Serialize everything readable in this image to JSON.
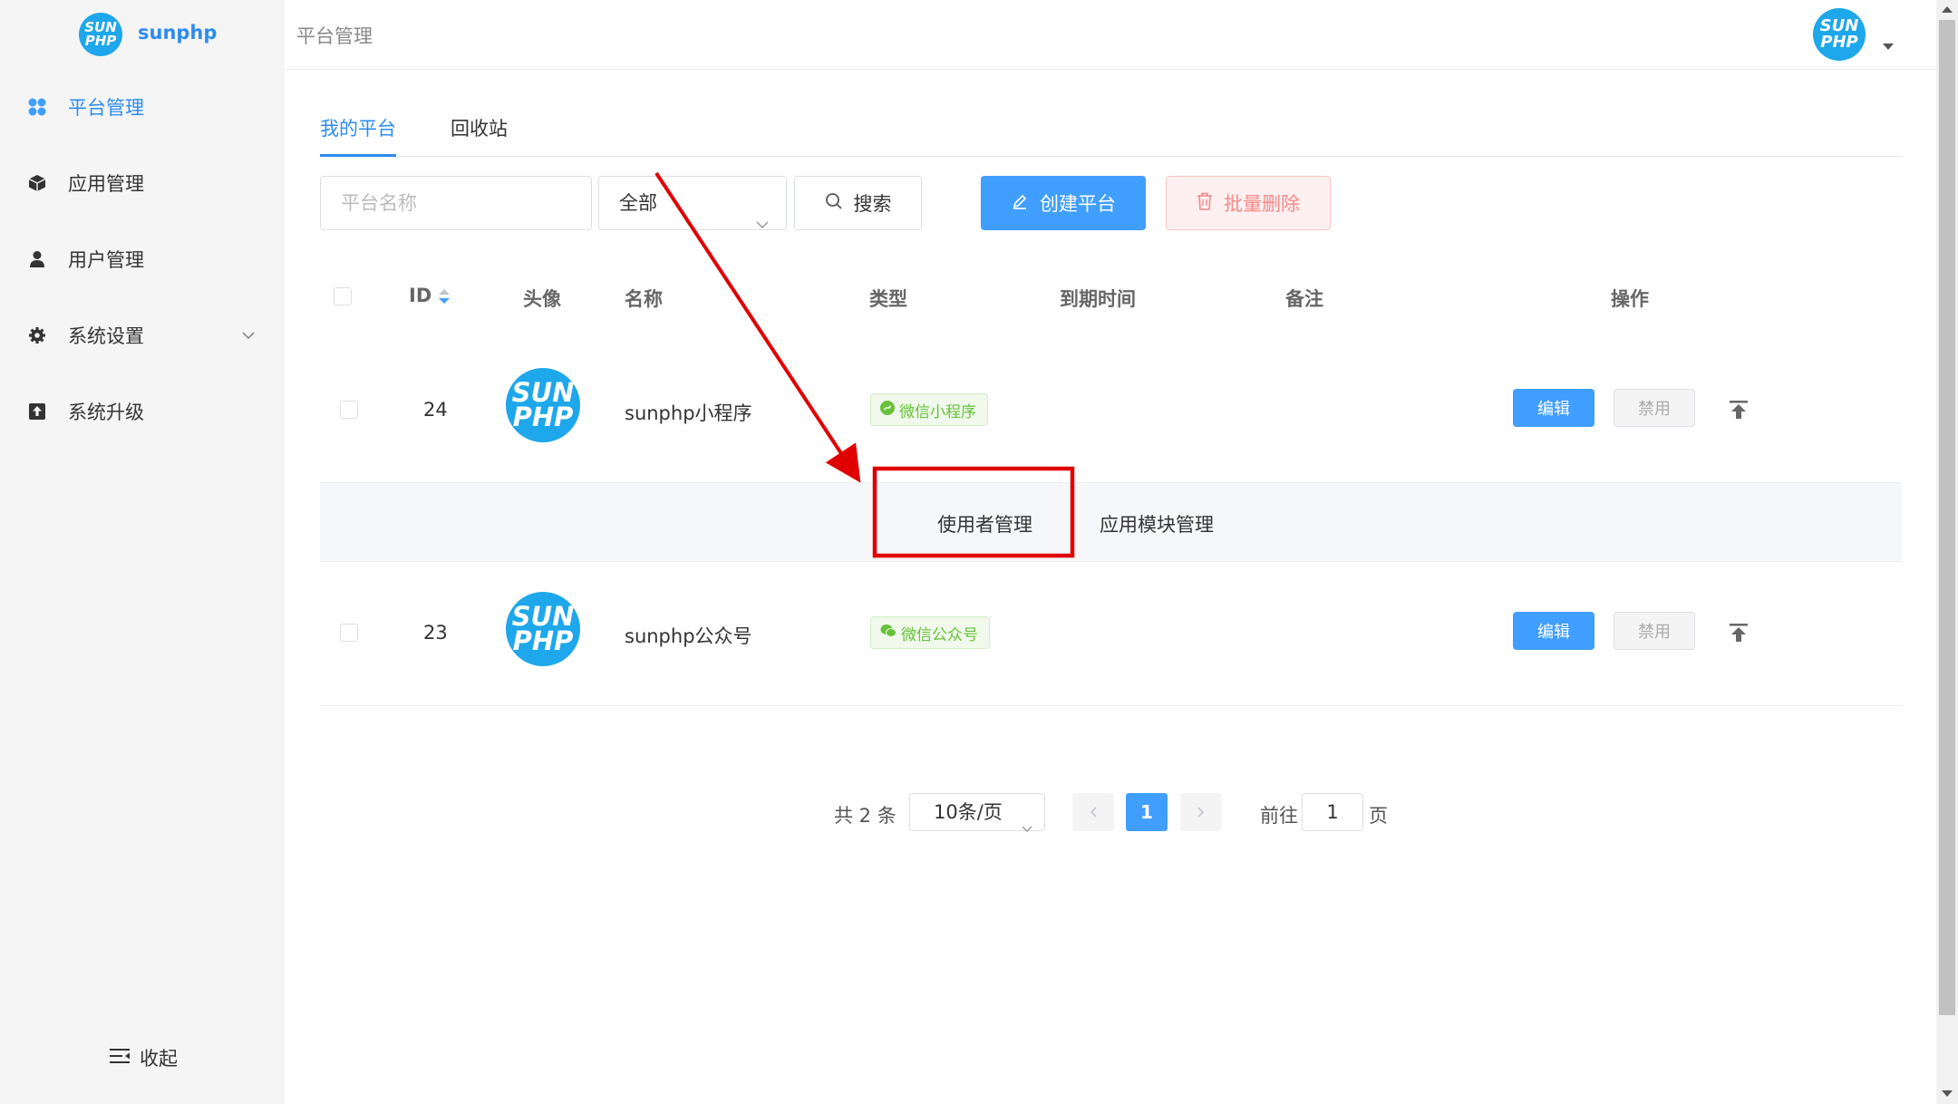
{
  "app": {
    "brand_name": "sunphp",
    "logo_text_1": "SUN",
    "logo_text_2": "PHP"
  },
  "header": {
    "breadcrumb": "平台管理"
  },
  "sidebar": {
    "items": [
      {
        "label": "平台管理",
        "icon": "grid-icon",
        "active": true
      },
      {
        "label": "应用管理",
        "icon": "cube-icon"
      },
      {
        "label": "用户管理",
        "icon": "user-icon"
      },
      {
        "label": "系统设置",
        "icon": "gear-icon",
        "has_children": true
      },
      {
        "label": "系统升级",
        "icon": "upload-icon"
      }
    ],
    "collapse_label": "收起"
  },
  "tabs": [
    {
      "label": "我的平台",
      "active": true
    },
    {
      "label": "回收站"
    }
  ],
  "filters": {
    "name_placeholder": "平台名称",
    "type_value": "全部",
    "search_label": "搜索",
    "create_label": "创建平台",
    "batch_delete_label": "批量删除"
  },
  "table": {
    "columns": [
      "ID",
      "头像",
      "名称",
      "类型",
      "到期时间",
      "备注",
      "操作"
    ],
    "rows": [
      {
        "id": "24",
        "name": "sunphp小程序",
        "type": "微信小程序",
        "expire": "",
        "note": ""
      },
      {
        "id": "23",
        "name": "sunphp公众号",
        "type": "微信公众号",
        "expire": "",
        "note": ""
      }
    ],
    "actions": {
      "edit": "编辑",
      "disable": "禁用"
    },
    "expand_links": [
      "使用者管理",
      "应用模块管理"
    ]
  },
  "pagination": {
    "total_text": "共 2 条",
    "page_size": "10条/页",
    "current_page": "1",
    "goto_label": "前往",
    "goto_value": "1",
    "page_suffix": "页"
  },
  "colors": {
    "primary": "#409eff",
    "brand_blue": "#1ea7ea",
    "annotation_red": "#e00000",
    "tag_green": "#67c23a"
  }
}
